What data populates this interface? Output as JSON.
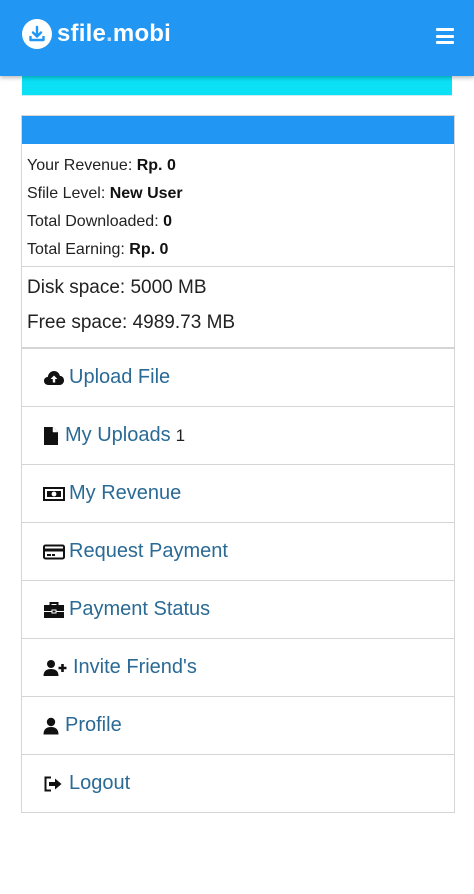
{
  "header": {
    "logo_name": "sfile",
    "logo_dot": ".",
    "logo_tld": "mobi",
    "menu_icon": "hamburger-menu-icon"
  },
  "stats": [
    {
      "label": "Your Revenue: ",
      "value": "Rp. 0"
    },
    {
      "label": "Sfile Level: ",
      "value": "New User"
    },
    {
      "label": "Total Downloaded: ",
      "value": "0"
    },
    {
      "label": "Total Earning: ",
      "value": "Rp. 0"
    }
  ],
  "disk": {
    "disk_space": "Disk space: 5000 MB",
    "free_space": "Free space: 4989.73 MB"
  },
  "menu": [
    {
      "label": "Upload File",
      "icon": "cloud-upload-icon"
    },
    {
      "label": "My Uploads",
      "icon": "file-icon",
      "count": "1"
    },
    {
      "label": "My Revenue",
      "icon": "money-bill-icon"
    },
    {
      "label": "Request Payment",
      "icon": "credit-card-icon"
    },
    {
      "label": "Payment Status",
      "icon": "briefcase-icon"
    },
    {
      "label": "Invite Friend's",
      "icon": "user-plus-icon"
    },
    {
      "label": "Profile",
      "icon": "user-icon"
    },
    {
      "label": "Logout",
      "icon": "sign-out-icon"
    }
  ],
  "colors": {
    "header": "#2196f3",
    "cyan_bar": "#0be0f4",
    "link": "#2a6a95"
  }
}
